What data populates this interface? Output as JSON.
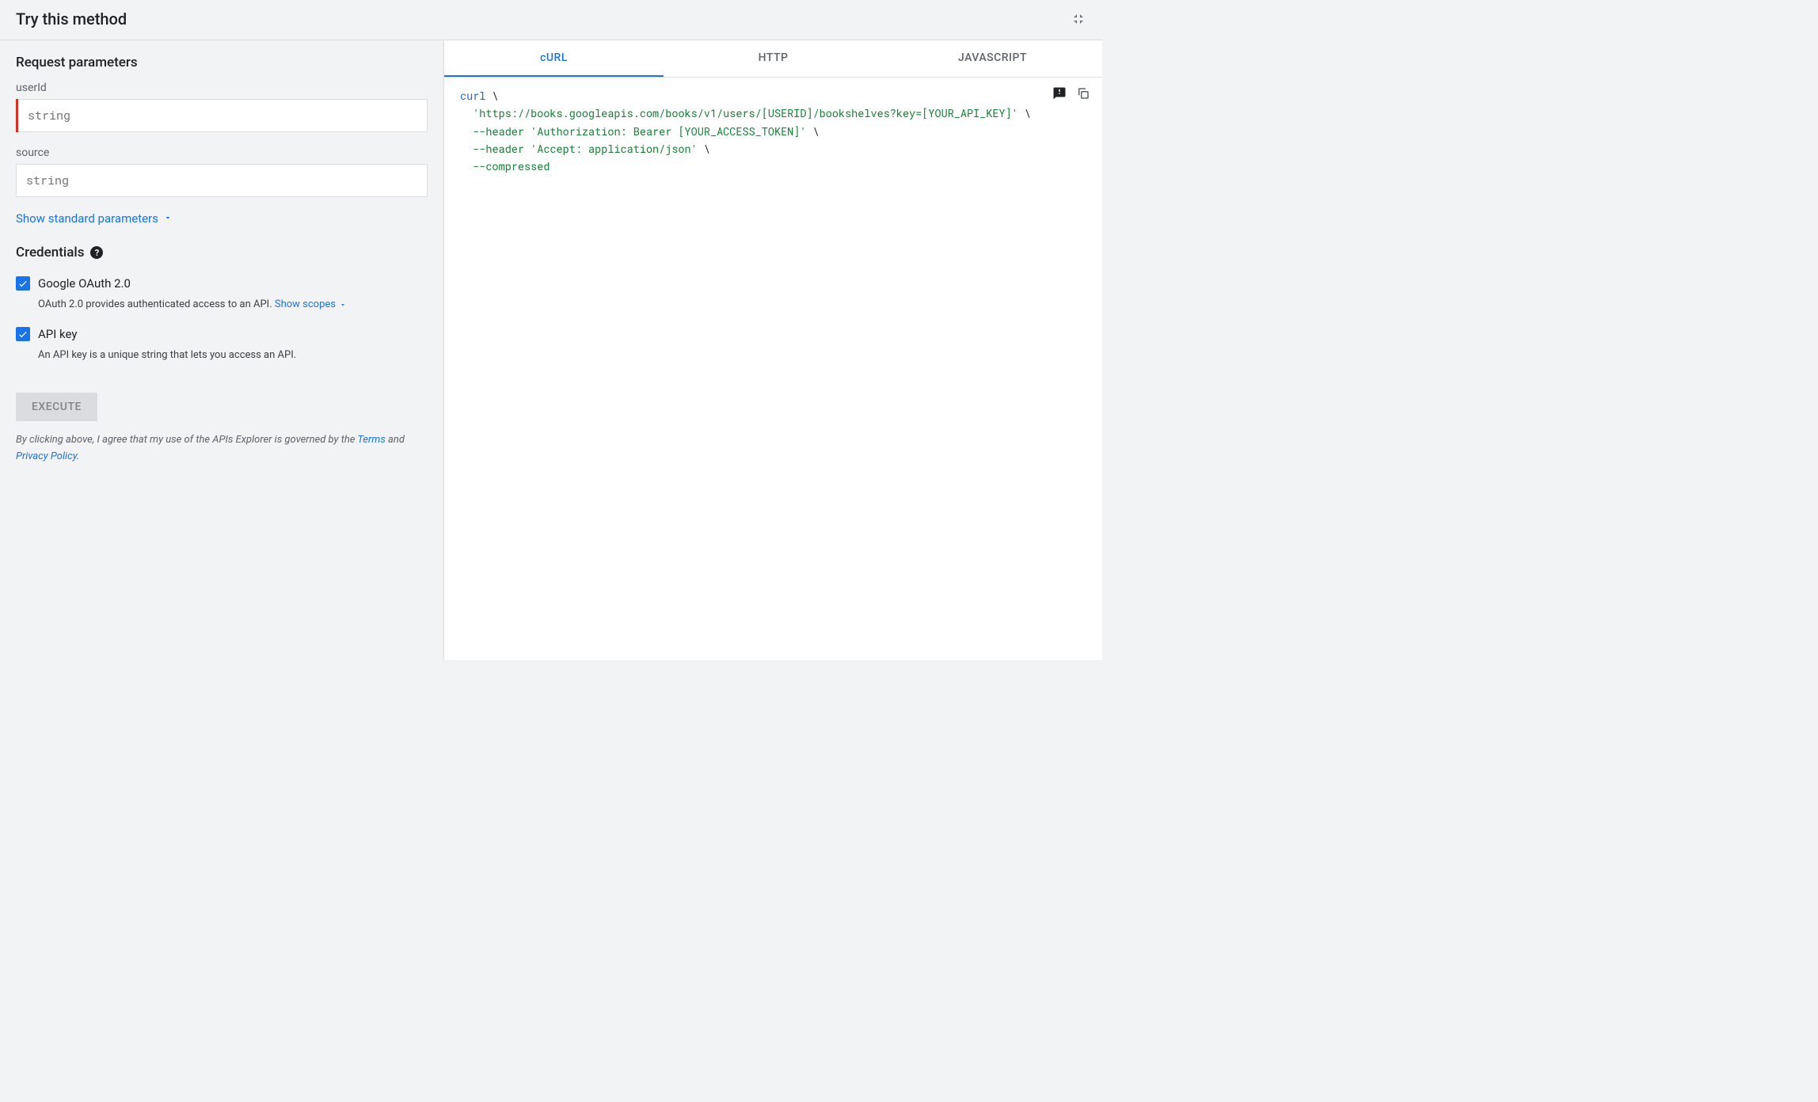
{
  "header": {
    "title": "Try this method"
  },
  "request": {
    "title": "Request parameters",
    "params": [
      {
        "label": "userId",
        "placeholder": "string",
        "required": true
      },
      {
        "label": "source",
        "placeholder": "string",
        "required": false
      }
    ],
    "show_standard": "Show standard parameters"
  },
  "credentials": {
    "title": "Credentials",
    "items": [
      {
        "label": "Google OAuth 2.0",
        "desc_pre": "OAuth 2.0 provides authenticated access to an API. ",
        "link": "Show scopes",
        "checked": true
      },
      {
        "label": "API key",
        "desc_pre": "An API key is a unique string that lets you access an API.",
        "link": "",
        "checked": true
      }
    ]
  },
  "execute": {
    "label": "EXECUTE",
    "agree_pre": "By clicking above, I agree that my use of the APIs Explorer is governed by the ",
    "terms": "Terms",
    "and": " and ",
    "privacy": "Privacy Policy",
    "dot": "."
  },
  "tabs": [
    "cURL",
    "HTTP",
    "JAVASCRIPT"
  ],
  "code": {
    "l1a": "curl",
    "l1b": " \\",
    "l2a": "  ",
    "l2b": "'https://books.googleapis.com/books/v1/users/[USERID]/bookshelves?key=[YOUR_API_KEY]'",
    "l2c": " \\",
    "l3a": "  ",
    "l3b": "--header",
    "l3c": " ",
    "l3d": "'Authorization: Bearer [YOUR_ACCESS_TOKEN]'",
    "l3e": " \\",
    "l4a": "  ",
    "l4b": "--header",
    "l4c": " ",
    "l4d": "'Accept: application/json'",
    "l4e": " \\",
    "l5a": "  ",
    "l5b": "--compressed"
  }
}
